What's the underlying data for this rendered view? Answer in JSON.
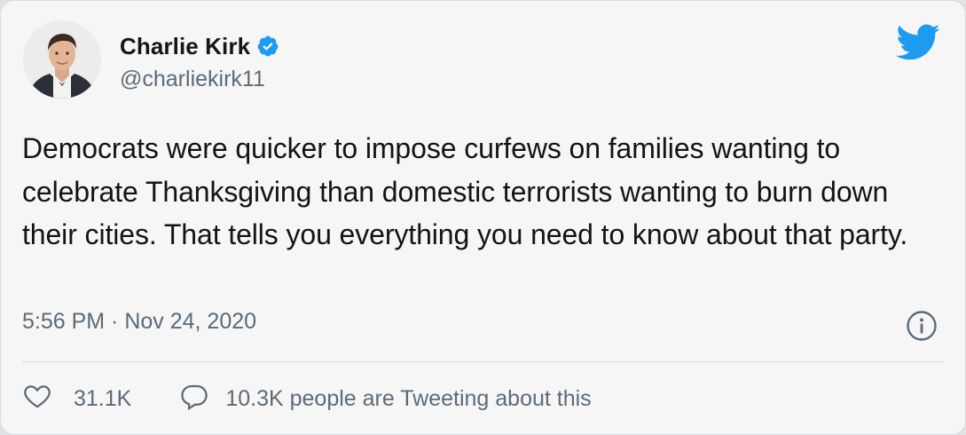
{
  "author": {
    "name": "Charlie Kirk",
    "handle": "@charliekirk11",
    "verified": true,
    "avatar_icon": "profile-photo"
  },
  "tweet": {
    "text": "Democrats were quicker to impose curfews on families wanting to celebrate Thanksgiving than domestic terrorists wanting to burn down their cities. That tells you everything you need to know about that party.",
    "timestamp": "5:56 PM · Nov 24, 2020"
  },
  "actions": {
    "likes": "31.1K",
    "tweeting": "10.3K people are Tweeting about this"
  },
  "colors": {
    "brand": "#1d9bf0",
    "text": "#121416",
    "secondary": "#5b6b79",
    "background": "#f6f6f6"
  }
}
